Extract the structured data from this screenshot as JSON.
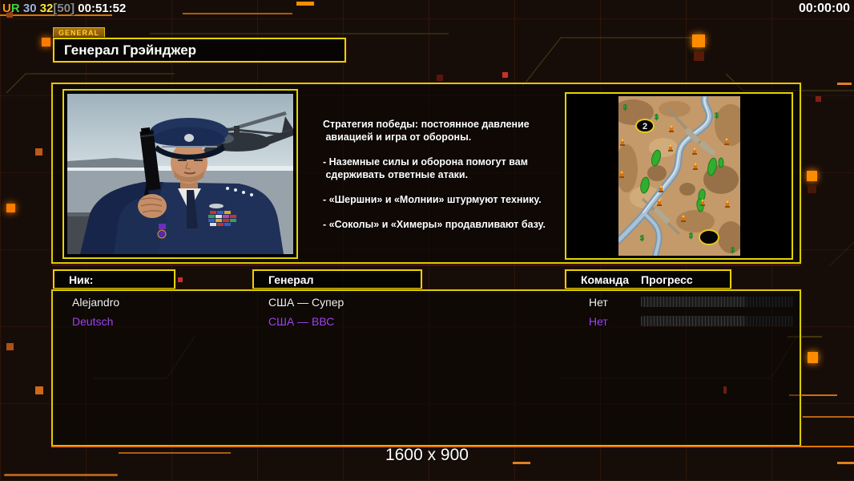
{
  "top_bar": {
    "score_parts": [
      {
        "text": "U",
        "color": "#ff9418"
      },
      {
        "text": "R",
        "color": "#3ed43e"
      },
      {
        "text": " 30",
        "color": "#9db4de"
      },
      {
        "text": " 32",
        "color": "#ffe93c"
      },
      {
        "text": "[50]",
        "color": "#8c8c8c"
      },
      {
        "text": " 00:51:52",
        "color": "#ffffff"
      }
    ],
    "match_time": "00:00:00"
  },
  "general_panel": {
    "tab_label": "GENERAL",
    "title": "Генерал Грэйнджер",
    "strategy_lines": [
      "Стратегия победы: постоянное давление",
      " авиацией и игра от обороны.",
      "",
      "- Наземные силы и оборона помогут вам",
      " сдерживать ответные атаки.",
      "",
      "- «Шершни» и «Молнии» штурмуют технику.",
      "",
      "- «Соколы» и «Химеры» продавливают базу."
    ]
  },
  "map_preview": {
    "start_position_label": "2",
    "money_symbol": "$"
  },
  "players": {
    "headers": {
      "nick": "Ник:",
      "general": "Генерал",
      "team": "Команда",
      "progress": "Прогресс"
    },
    "rows": [
      {
        "nick": "Alejandro",
        "general": "США — Супер",
        "team": "Нет",
        "color": "#f2f2f2",
        "progress_percent": 0
      },
      {
        "nick": "Deutsch",
        "general": "США — ВВС",
        "team": "Нет",
        "color": "#a444f2",
        "progress_percent": 1.5
      }
    ]
  },
  "footer": {
    "resolution": "1600 x 900"
  },
  "theme": {
    "accent_yellow": "#e3d400",
    "accent_orange": "#e07800",
    "purple": "#a444f2"
  }
}
